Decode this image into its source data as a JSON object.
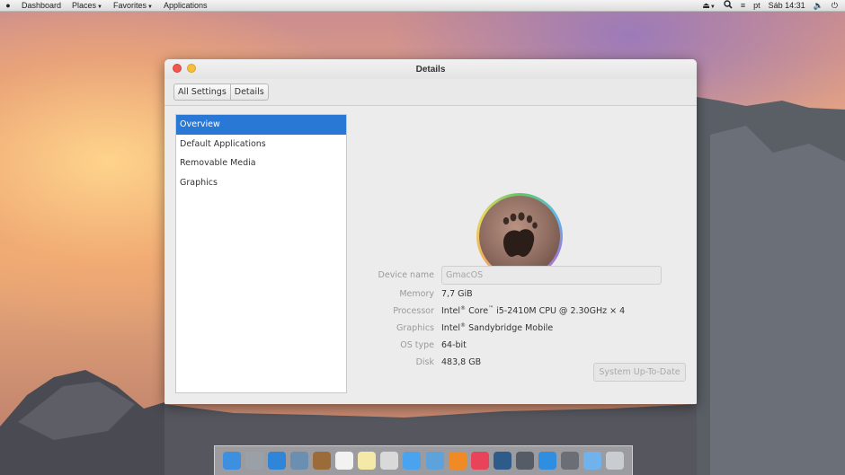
{
  "topbar": {
    "menus": [
      {
        "label": "Dashboard",
        "has_caret": false
      },
      {
        "label": "Places",
        "has_caret": true
      },
      {
        "label": "Favorites",
        "has_caret": true
      },
      {
        "label": "Applications",
        "has_caret": false
      }
    ],
    "language": "pt",
    "clock": "Sáb 14:31"
  },
  "window": {
    "title": "Details",
    "breadcrumbs": [
      "All Settings",
      "Details"
    ],
    "sidebar": [
      {
        "label": "Overview",
        "selected": true
      },
      {
        "label": "Default Applications",
        "selected": false
      },
      {
        "label": "Removable Media",
        "selected": false
      },
      {
        "label": "Graphics",
        "selected": false
      }
    ],
    "details": {
      "device_label": "Device name",
      "device_value": "GmacOS",
      "memory_label": "Memory",
      "memory_value": "7,7 GiB",
      "processor_label": "Processor",
      "processor_brand": "Intel",
      "processor_reg": "®",
      "processor_core": " Core",
      "processor_tm": "™",
      "processor_model": " i5-2410M CPU @ 2.30GHz × 4",
      "graphics_label": "Graphics",
      "graphics_brand": "Intel",
      "graphics_reg": "®",
      "graphics_model": " Sandybridge Mobile",
      "ostype_label": "OS type",
      "ostype_value": "64-bit",
      "disk_label": "Disk",
      "disk_value": "483,8 GB"
    },
    "update_button": "System Up-To-Date"
  },
  "dock": {
    "icons": [
      {
        "name": "finder-icon",
        "color": "#3d8fe0"
      },
      {
        "name": "launchpad-icon",
        "color": "#9aa0a8"
      },
      {
        "name": "safari-icon",
        "color": "#2f86d8"
      },
      {
        "name": "preview-icon",
        "color": "#6a8fb0"
      },
      {
        "name": "notes-book-icon",
        "color": "#9b6b3a"
      },
      {
        "name": "calendar-icon",
        "color": "#f2f2f2"
      },
      {
        "name": "stickies-icon",
        "color": "#f4e9a6"
      },
      {
        "name": "textedit-icon",
        "color": "#d9d9d9"
      },
      {
        "name": "messages-icon",
        "color": "#4aa3ef"
      },
      {
        "name": "mail-icon",
        "color": "#5ea2dc"
      },
      {
        "name": "ibooks-icon",
        "color": "#f08a24"
      },
      {
        "name": "itunes-icon",
        "color": "#e9435a"
      },
      {
        "name": "quicktime-icon",
        "color": "#2e5c8a"
      },
      {
        "name": "time-machine-icon",
        "color": "#555c66"
      },
      {
        "name": "app-store-icon",
        "color": "#2f8ee0"
      },
      {
        "name": "system-preferences-icon",
        "color": "#6b6f75"
      },
      {
        "name": "folder-icon",
        "color": "#6fb2ec"
      },
      {
        "name": "trash-icon",
        "color": "#c9ccd0"
      }
    ]
  }
}
